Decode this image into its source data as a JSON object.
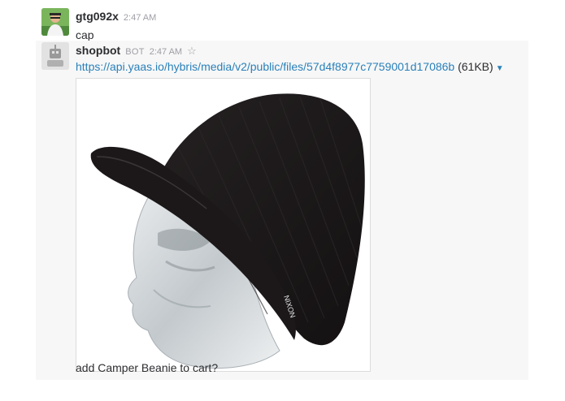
{
  "messages": [
    {
      "user": "gtg092x",
      "time": "2:47 AM",
      "text": "cap"
    },
    {
      "user": "shopbot",
      "badge": "BOT",
      "time": "2:47 AM",
      "star_icon": "star-outline-icon",
      "link": "https://api.yaas.io/hybris/media/v2/public/files/57d4f8977c7759001d17086b",
      "file_size": "(61KB)",
      "caret_icon": "caret-down-icon",
      "image_subject": "black brimmed beanie on a clear mannequin head"
    },
    {
      "text": "add Camper Beanie to cart?"
    }
  ],
  "colors": {
    "link": "#2a80b9",
    "hat": "#1a1718",
    "message_hover_bg": "#f7f7f7"
  }
}
